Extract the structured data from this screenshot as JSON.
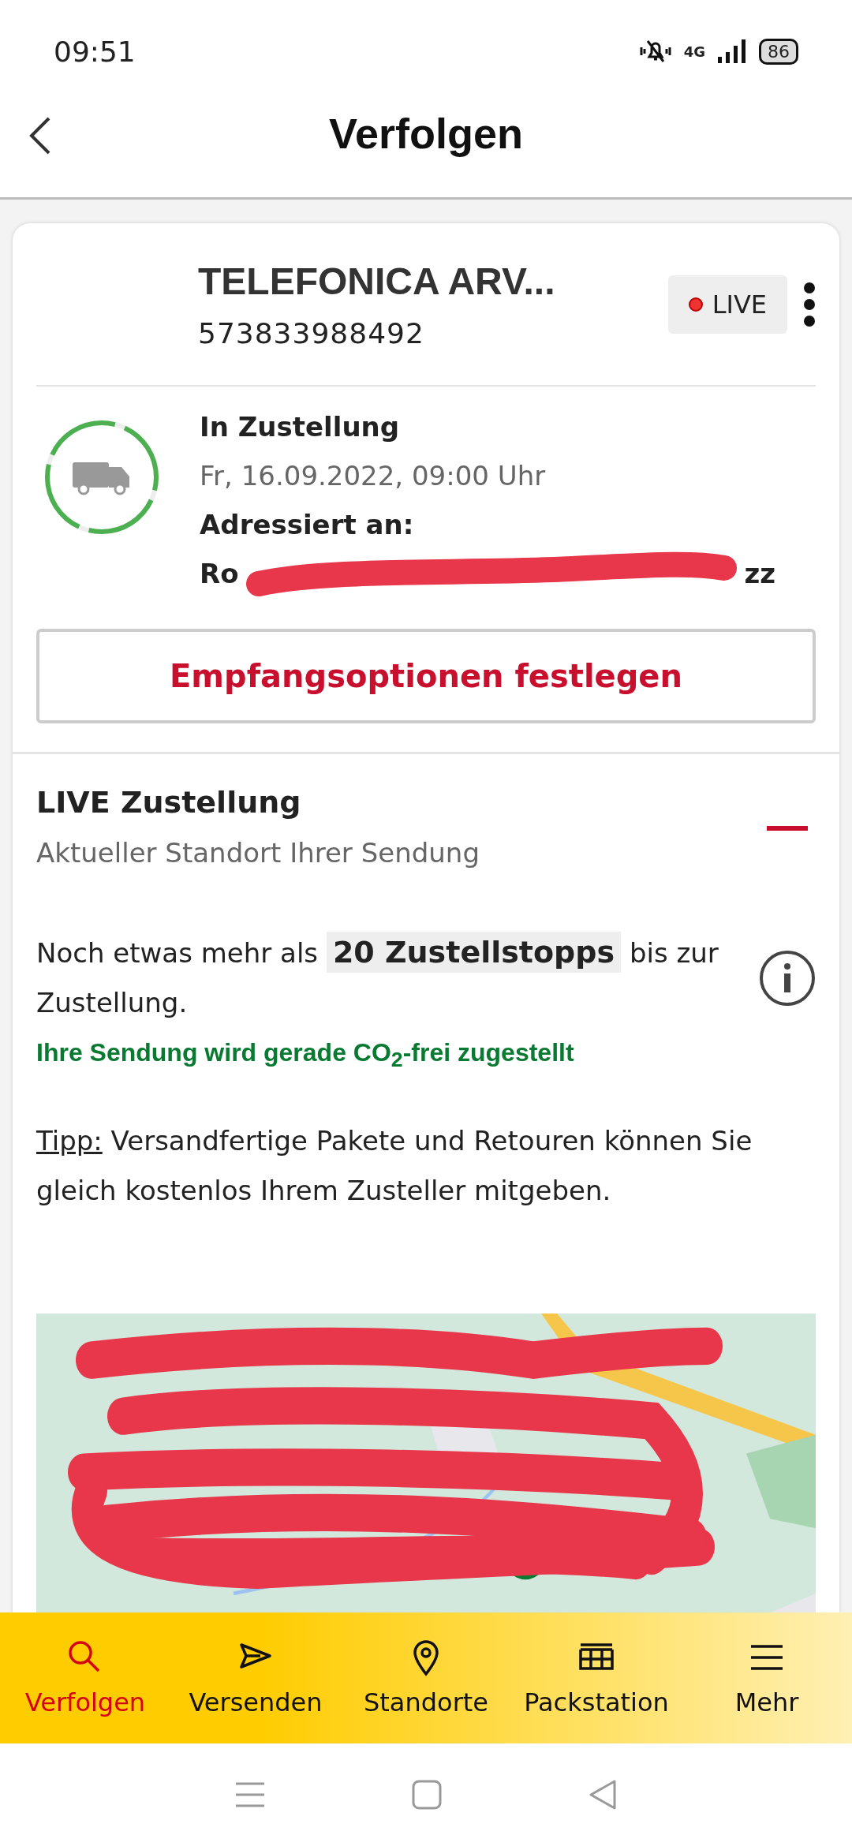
{
  "status_bar": {
    "time": "09:51",
    "network": "4G",
    "battery": "86"
  },
  "header": {
    "title": "Verfolgen"
  },
  "shipment": {
    "sender": "TELEFONICA ARV...",
    "number": "573833988492",
    "live_badge": "LIVE",
    "status": "In Zustellung",
    "date": "Fr, 16.09.2022, 09:00 Uhr",
    "address_label": "Adressiert an:",
    "address_start": "Ro",
    "address_end": "zz",
    "redacted": true,
    "action_button": "Empfangsoptionen festlegen"
  },
  "live_section": {
    "title": "LIVE Zustellung",
    "subtitle": "Aktueller Standort Ihrer Sendung",
    "expanded": true,
    "stops_text": "Noch etwas mehr als **20 Zustellstopps** bis zur Zustellung.",
    "co2_text": "Ihre Sendung wird gerade CO$_{2}$-frei zugestellt",
    "tip_label": "Tipp:",
    "tip_text": "Versandfertige Pakete und Retouren können Sie gleich kostenlos Ihrem Zusteller mitgeben.",
    "map": {
      "kind": "picture",
      "redacted": true
    }
  },
  "bottom_nav": [
    {
      "label": "Verfolgen",
      "kind": "search",
      "selected": true
    },
    {
      "label": "Versenden",
      "kind": "send",
      "selected": false
    },
    {
      "label": "Standorte",
      "kind": "pin",
      "selected": false
    },
    {
      "label": "Packstation",
      "kind": "station",
      "selected": false
    },
    {
      "label": "Mehr",
      "kind": "menu",
      "selected": false
    }
  ]
}
